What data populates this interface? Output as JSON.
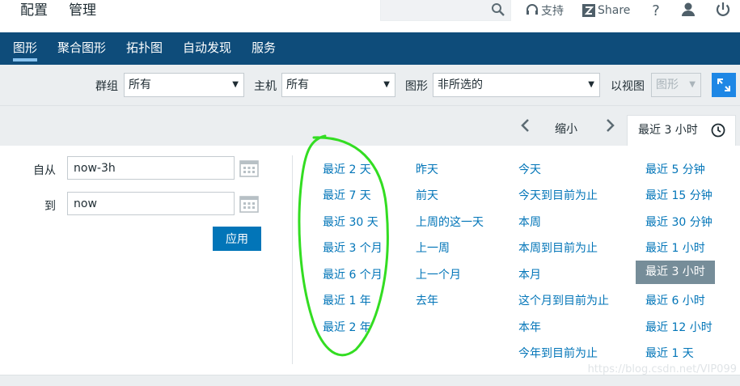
{
  "top_menu": {
    "config": "配置",
    "admin": "管理"
  },
  "search": {
    "value": "",
    "placeholder": ""
  },
  "top_links": {
    "support": "支持",
    "share": "Share"
  },
  "nav": {
    "items": [
      "图形",
      "聚合图形",
      "拓扑图",
      "自动发现",
      "服务"
    ],
    "active": "图形"
  },
  "filter": {
    "group_label": "群组",
    "group_value": "所有",
    "host_label": "主机",
    "host_value": "所有",
    "graph_label": "图形",
    "graph_value": "非所选的",
    "view_label": "以视图",
    "view_value": "图形"
  },
  "timebar": {
    "zoom_out": "缩小",
    "tab_label": "最近 3 小时"
  },
  "range": {
    "from_label": "自从",
    "from_value": "now-3h",
    "to_label": "到",
    "to_value": "now",
    "apply_label": "应用"
  },
  "quick_ranges": {
    "col1": [
      "最近 2 天",
      "最近 7 天",
      "最近 30 天",
      "最近 3 个月",
      "最近 6 个月",
      "最近 1 年",
      "最近 2 年"
    ],
    "col2": [
      "昨天",
      "前天",
      "上周的这一天",
      "上一周",
      "上一个月",
      "去年"
    ],
    "col3": [
      "今天",
      "今天到目前为止",
      "本周",
      "本周到目前为止",
      "本月",
      "这个月到目前为止",
      "本年",
      "今年到目前为止"
    ],
    "col4": [
      "最近 5 分钟",
      "最近 15 分钟",
      "最近 30 分钟",
      "最近 1 小时",
      "最近 3 小时",
      "最近 6 小时",
      "最近 12 小时",
      "最近 1 天"
    ],
    "selected": "最近 3 小时"
  },
  "watermark": "https://blog.csdn.net/VIP099",
  "colors": {
    "nav_bg": "#0e4c7a",
    "link": "#0275b8",
    "selected_bg": "#768d99",
    "annotation": "#33dd22"
  }
}
